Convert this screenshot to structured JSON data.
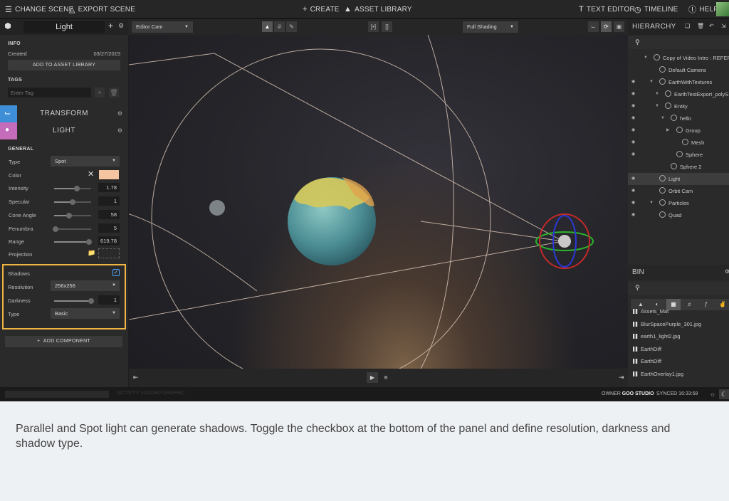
{
  "topbar": {
    "change_scene": "CHANGE SCENE",
    "export_scene": "EXPORT SCENE",
    "create": "CREATE",
    "asset_library": "ASSET LIBRARY",
    "text_editor": "TEXT EDITOR",
    "timeline": "TIMELINE",
    "help": "HELP"
  },
  "entity": {
    "name": "Light"
  },
  "info": {
    "section": "INFO",
    "created_label": "Created",
    "created_value": "03/27/2015",
    "add_to_library": "ADD TO ASSET LIBRARY",
    "tags_section": "TAGS",
    "tag_placeholder": "Enter Tag"
  },
  "components": {
    "transform": "TRANSFORM",
    "light": "LIGHT",
    "transform_color": "#3f8fd8",
    "light_color": "#c46bb9"
  },
  "light": {
    "general": "GENERAL",
    "type_label": "Type",
    "type_value": "Spot",
    "color_label": "Color",
    "color_value": "#f5c4a0",
    "intensity_label": "Intensity",
    "intensity_value": "1.78",
    "intensity_level": 0.62,
    "specular_label": "Specular",
    "specular_value": "1",
    "specular_level": 0.5,
    "cone_label": "Cone Angle",
    "cone_value": "58",
    "cone_level": 0.4,
    "penumbra_label": "Penumbra",
    "penumbra_value": "5",
    "penumbra_level": 0.03,
    "range_label": "Range",
    "range_value": "619.78",
    "range_level": 0.95,
    "projection_label": "Projection"
  },
  "shadows": {
    "label": "Shadows",
    "checked": true,
    "resolution_label": "Resolution",
    "resolution_value": "256x256",
    "darkness_label": "Darkness",
    "darkness_value": "1",
    "darkness_level": 1.0,
    "type_label": "Type",
    "type_value": "Basic"
  },
  "add_component": "ADD COMPONENT",
  "viewport": {
    "camera": "Editor Cam",
    "shading": "Full Shading"
  },
  "hierarchy": {
    "title": "HIERARCHY",
    "items": [
      {
        "label": "Copy of Video Intro : REFERE",
        "depth": 0,
        "arrow": true,
        "eye": false
      },
      {
        "label": "Default Camera",
        "depth": 1,
        "arrow": false,
        "eye": false
      },
      {
        "label": "EarthWithTextures",
        "depth": 1,
        "arrow": true,
        "eye": true
      },
      {
        "label": "EarthTestExport_polyS",
        "depth": 2,
        "arrow": true,
        "eye": true
      },
      {
        "label": "Entity",
        "depth": 2,
        "arrow": true,
        "eye": true
      },
      {
        "label": "hello",
        "depth": 3,
        "arrow": true,
        "eye": true
      },
      {
        "label": "Group",
        "depth": 4,
        "arrow": true,
        "eye": true
      },
      {
        "label": "Mesh",
        "depth": 5,
        "arrow": false,
        "eye": true
      },
      {
        "label": "Sphere",
        "depth": 4,
        "arrow": false,
        "eye": true
      },
      {
        "label": "Sphere 2",
        "depth": 3,
        "arrow": false,
        "eye": false
      },
      {
        "label": "Light",
        "depth": 1,
        "arrow": false,
        "eye": true,
        "selected": true
      },
      {
        "label": "Orbit Cam",
        "depth": 1,
        "arrow": false,
        "eye": true
      },
      {
        "label": "Particles",
        "depth": 1,
        "arrow": true,
        "eye": true
      },
      {
        "label": "Quad",
        "depth": 1,
        "arrow": false,
        "eye": true
      }
    ]
  },
  "bin": {
    "title": "BIN",
    "items": [
      "Assets_Mat",
      "BlurSpacePurple_301.jpg",
      "earth1_light2.jpg",
      "EarthDiff",
      "EarthDiff",
      "EarthOverlay1.jpg"
    ]
  },
  "status": {
    "owner_label": "OWNER",
    "owner_value": "GOO STUDIO",
    "synced": "SYNCED 16:33:58",
    "ghost_text": "ACTIVITY LOADED GRAPHIC"
  },
  "caption": "Parallel and Spot light can generate shadows. Toggle the checkbox at the bottom of the panel and define resolution, darkness and shadow type."
}
